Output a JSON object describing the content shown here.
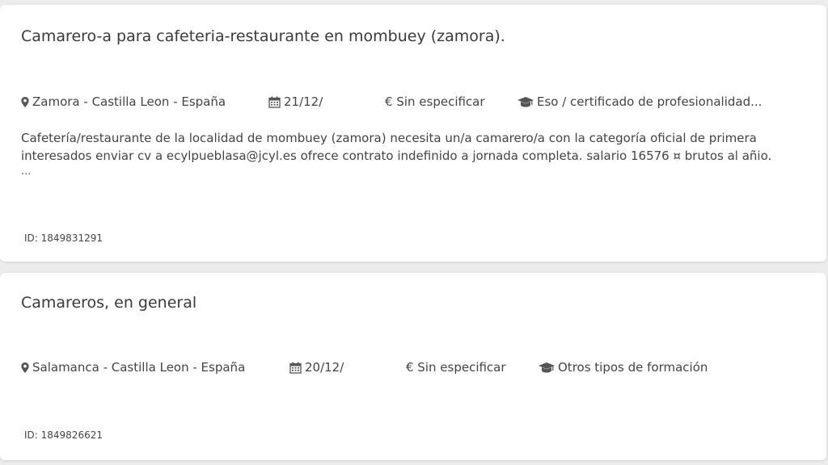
{
  "jobs": [
    {
      "title": "Camarero-a para cafeteria-restaurante en mombuey (zamora).",
      "location": "Zamora - Castilla Leon - España",
      "date": "21/12/",
      "salary": "€ Sin especificar",
      "education": "Eso / certificado de profesionalidad...",
      "description": "Cafetería/restaurante de la localidad de mombuey (zamora) necesita un/a camarero/a con la categoría oficial de primera interesados enviar cv a ecylpueblasa@jcyl.es ofrece contrato indefinido a jornada completa. salario 16576 ¤ brutos al añio.",
      "ellipsis": "...",
      "id": "ID: 1849831291"
    },
    {
      "title": "Camareros, en general",
      "location": "Salamanca - Castilla Leon - España",
      "date": "20/12/",
      "salary": "€ Sin especificar",
      "education": "Otros tipos de formación",
      "id": "ID: 1849826621"
    }
  ],
  "icons": {
    "location": "map-marker-icon",
    "date": "calendar-icon",
    "education": "graduation-cap-icon"
  },
  "colors": {
    "background": "#ececec",
    "card": "#ffffff",
    "text": "#333333"
  }
}
